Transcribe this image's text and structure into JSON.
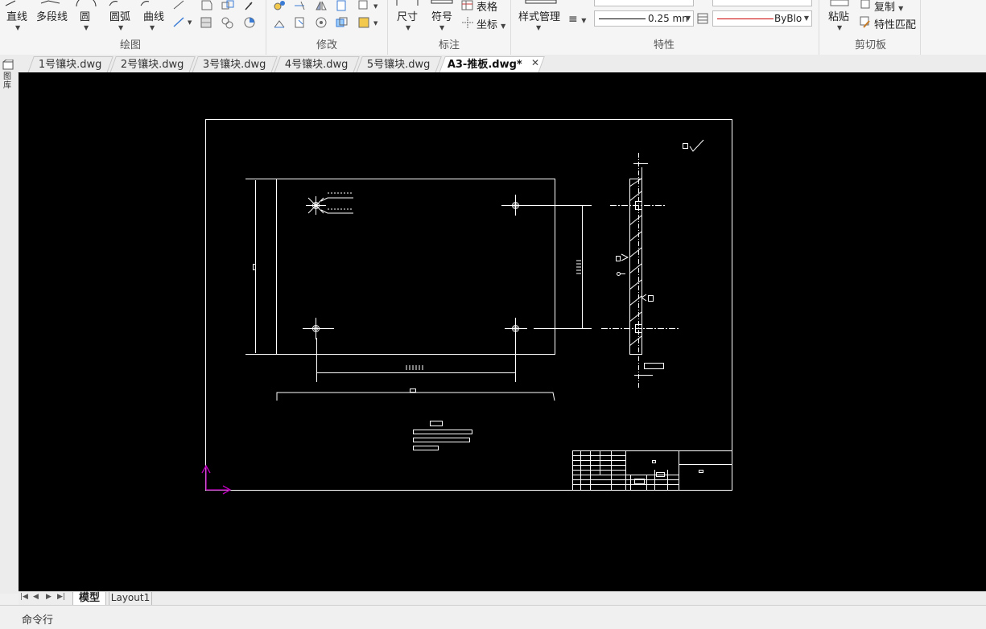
{
  "ribbon": {
    "draw_group": {
      "label": "绘图",
      "line": "直线",
      "polyline": "多段线",
      "circle": "圆",
      "arc": "圆弧",
      "curve": "曲线"
    },
    "modify_group": {
      "label": "修改"
    },
    "annotate_group": {
      "label": "标注",
      "dimension": "尺寸",
      "symbol": "符号",
      "table": "表格",
      "coordinate": "坐标"
    },
    "properties_group": {
      "label": "特性",
      "style_manager": "样式管理",
      "lineweight": "0.25 mn",
      "color": "ByBlo"
    },
    "clipboard_group": {
      "label": "剪切板",
      "paste": "粘贴",
      "copy": "复制",
      "match_properties": "特性匹配"
    }
  },
  "document_tabs": [
    {
      "label": "1号镶块.dwg",
      "active": false
    },
    {
      "label": "2号镶块.dwg",
      "active": false
    },
    {
      "label": "3号镶块.dwg",
      "active": false
    },
    {
      "label": "4号镶块.dwg",
      "active": false
    },
    {
      "label": "5号镶块.dwg",
      "active": false
    },
    {
      "label": "A3-推板.dwg*",
      "active": true
    }
  ],
  "close_tab_icon": "close-icon",
  "left_panel": {
    "label": "图库"
  },
  "layout_tabs": {
    "model": "模型",
    "layout1": "Layout1"
  },
  "command_line": {
    "label": "命令行"
  },
  "colors": {
    "canvas_bg": "#000000",
    "drawing_lines": "#ffffff",
    "ucs_icon": "#c000c0",
    "lineweight_sample": "#000000",
    "color_sample": "#cc0000"
  }
}
